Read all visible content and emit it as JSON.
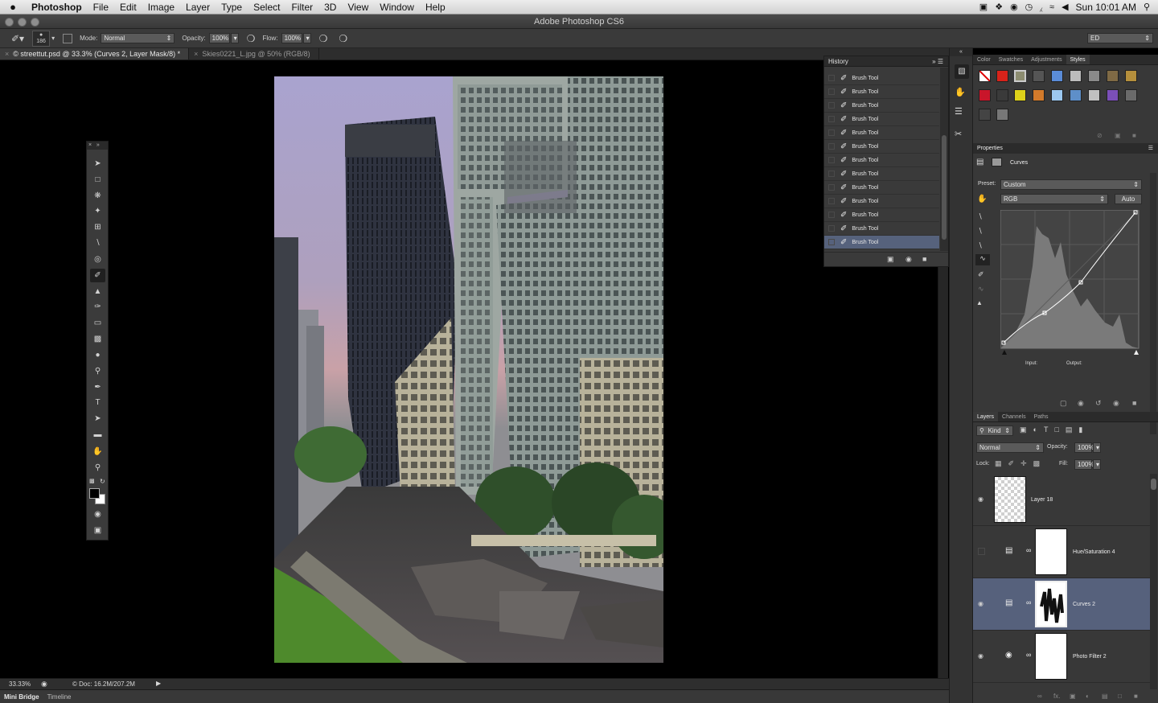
{
  "menubar": {
    "app_name": "Photoshop",
    "items": [
      "File",
      "Edit",
      "Image",
      "Layer",
      "Type",
      "Select",
      "Filter",
      "3D",
      "View",
      "Window",
      "Help"
    ],
    "clock": "Sun 10:01 AM"
  },
  "window": {
    "title": "Adobe Photoshop CS6"
  },
  "options_bar": {
    "brush_size": "186",
    "mode_label": "Mode:",
    "mode_value": "Normal",
    "opacity_label": "Opacity:",
    "opacity_value": "100%",
    "flow_label": "Flow:",
    "flow_value": "100%",
    "workspace": "ED"
  },
  "document_tabs": [
    {
      "label": "© streettut.psd @ 33.3% (Curves 2, Layer Mask/8) *",
      "active": true
    },
    {
      "label": "Skies0221_L.jpg @ 50% (RGB/8)",
      "active": false
    }
  ],
  "status": {
    "zoom": "33.33%",
    "doc": "Doc: 16.2M/207.2M"
  },
  "bottom_tabs": [
    "Mini Bridge",
    "Timeline"
  ],
  "history": {
    "title": "History",
    "items": [
      "Brush Tool",
      "Brush Tool",
      "Brush Tool",
      "Brush Tool",
      "Brush Tool",
      "Brush Tool",
      "Brush Tool",
      "Brush Tool",
      "Brush Tool",
      "Brush Tool",
      "Brush Tool",
      "Brush Tool",
      "Brush Tool"
    ]
  },
  "swatch_panel": {
    "tabs": [
      "Color",
      "Swatches",
      "Adjustments",
      "Styles"
    ],
    "active_tab": "Styles"
  },
  "properties": {
    "title": "Properties",
    "adjustment": "Curves",
    "preset_label": "Preset:",
    "preset_value": "Custom",
    "channel": "RGB",
    "auto_label": "Auto",
    "input_label": "Input:",
    "output_label": "Output:"
  },
  "layers_panel": {
    "tabs": [
      "Layers",
      "Channels",
      "Paths"
    ],
    "kind_label": "Kind",
    "blend_mode": "Normal",
    "opacity_label": "Opacity:",
    "opacity_value": "100%",
    "lock_label": "Lock:",
    "fill_label": "Fill:",
    "fill_value": "100%",
    "layers": [
      {
        "name": "Layer 18",
        "visible": true,
        "selected": false
      },
      {
        "name": "Hue/Saturation 4",
        "visible": false,
        "selected": false
      },
      {
        "name": "Curves 2",
        "visible": true,
        "selected": true
      },
      {
        "name": "Photo Filter 2",
        "visible": true,
        "selected": false
      }
    ]
  },
  "colors": {
    "selection": "#56627c",
    "panel_bg": "#383838",
    "foreground": "#000000",
    "background": "#ffffff"
  }
}
